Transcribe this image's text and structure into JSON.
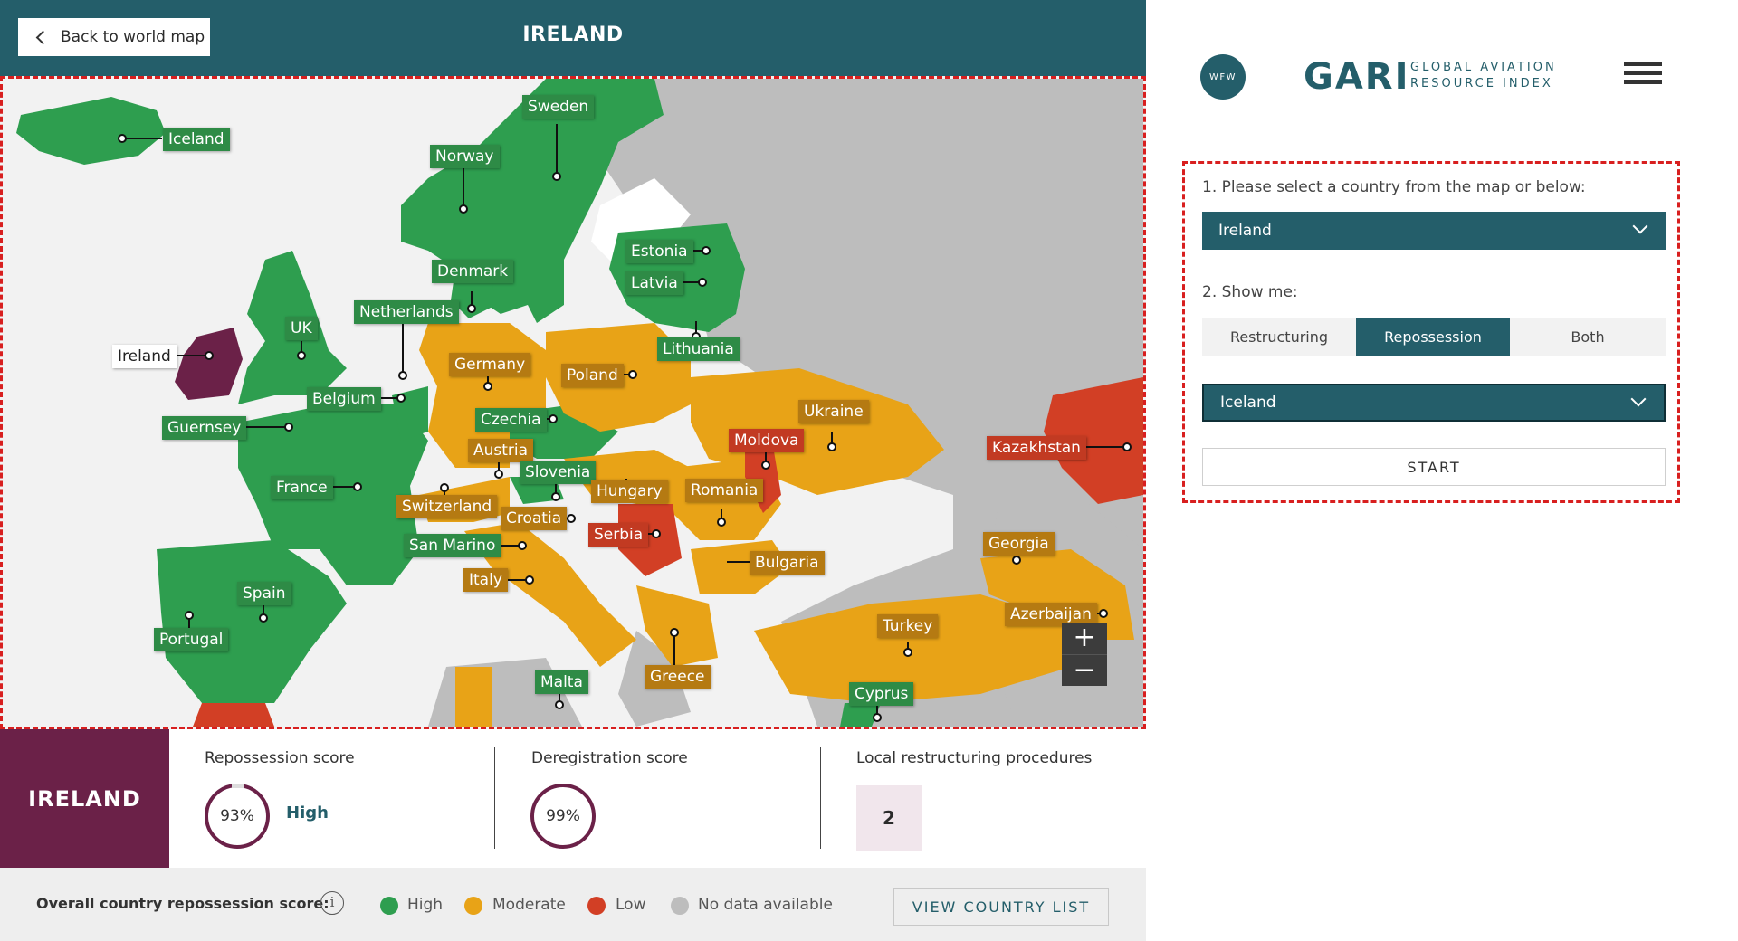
{
  "header": {
    "back_label": "Back to world map",
    "title": "IRELAND"
  },
  "map": {
    "labels": [
      {
        "name": "Iceland",
        "rating": "high"
      },
      {
        "name": "Sweden",
        "rating": "high"
      },
      {
        "name": "Norway",
        "rating": "high"
      },
      {
        "name": "Estonia",
        "rating": "high"
      },
      {
        "name": "Latvia",
        "rating": "high"
      },
      {
        "name": "Denmark",
        "rating": "high"
      },
      {
        "name": "Lithuania",
        "rating": "high"
      },
      {
        "name": "Netherlands",
        "rating": "high"
      },
      {
        "name": "UK",
        "rating": "high"
      },
      {
        "name": "Ireland",
        "rating": "selected"
      },
      {
        "name": "Germany",
        "rating": "moderate"
      },
      {
        "name": "Poland",
        "rating": "moderate"
      },
      {
        "name": "Belgium",
        "rating": "high"
      },
      {
        "name": "Guernsey",
        "rating": "high"
      },
      {
        "name": "Czechia",
        "rating": "high"
      },
      {
        "name": "Ukraine",
        "rating": "moderate"
      },
      {
        "name": "Moldova",
        "rating": "low"
      },
      {
        "name": "Kazakhstan",
        "rating": "low"
      },
      {
        "name": "Austria",
        "rating": "moderate"
      },
      {
        "name": "Slovenia",
        "rating": "high"
      },
      {
        "name": "France",
        "rating": "high"
      },
      {
        "name": "Hungary",
        "rating": "moderate"
      },
      {
        "name": "Romania",
        "rating": "moderate"
      },
      {
        "name": "Switzerland",
        "rating": "moderate"
      },
      {
        "name": "Croatia",
        "rating": "moderate"
      },
      {
        "name": "Serbia",
        "rating": "low"
      },
      {
        "name": "Georgia",
        "rating": "moderate"
      },
      {
        "name": "San Marino",
        "rating": "high"
      },
      {
        "name": "Bulgaria",
        "rating": "moderate"
      },
      {
        "name": "Italy",
        "rating": "moderate"
      },
      {
        "name": "Spain",
        "rating": "high"
      },
      {
        "name": "Azerbaijan",
        "rating": "moderate"
      },
      {
        "name": "Portugal",
        "rating": "high"
      },
      {
        "name": "Turkey",
        "rating": "moderate"
      },
      {
        "name": "Malta",
        "rating": "high"
      },
      {
        "name": "Greece",
        "rating": "moderate"
      },
      {
        "name": "Cyprus",
        "rating": "high"
      }
    ],
    "zoom_in": "+",
    "zoom_out": "−"
  },
  "stats": {
    "country": "IRELAND",
    "repossession_label": "Repossession score",
    "repossession_value": "93%",
    "repossession_rating": "High",
    "deregistration_label": "Deregistration score",
    "deregistration_value": "99%",
    "procedures_label": "Local restructuring procedures",
    "procedures_value": "2"
  },
  "legend": {
    "title": "Overall country repossession score:",
    "info": "i",
    "items": [
      {
        "label": "High",
        "color": "#2e9e4f"
      },
      {
        "label": "Moderate",
        "color": "#e8a317"
      },
      {
        "label": "Low",
        "color": "#d23f25"
      },
      {
        "label": "No data available",
        "color": "#bdbdbd"
      }
    ],
    "view_list": "VIEW COUNTRY LIST"
  },
  "brand": {
    "wfw": "WFW",
    "gari": "GARI",
    "gari_sub": "GLOBAL AVIATION RESOURCE INDEX"
  },
  "form": {
    "step1_label": "1. Please select a country from the map or below:",
    "country_select": "Ireland",
    "step2_label": "2. Show me:",
    "segments": [
      "Restructuring",
      "Repossession",
      "Both"
    ],
    "active_segment": "Repossession",
    "compare_select": "Iceland",
    "start": "START"
  },
  "colors": {
    "teal": "#245e6a",
    "high": "#2e9e4f",
    "moderate": "#e8a317",
    "low": "#d23f25",
    "no_data": "#bdbdbd",
    "selected": "#6b2148"
  }
}
